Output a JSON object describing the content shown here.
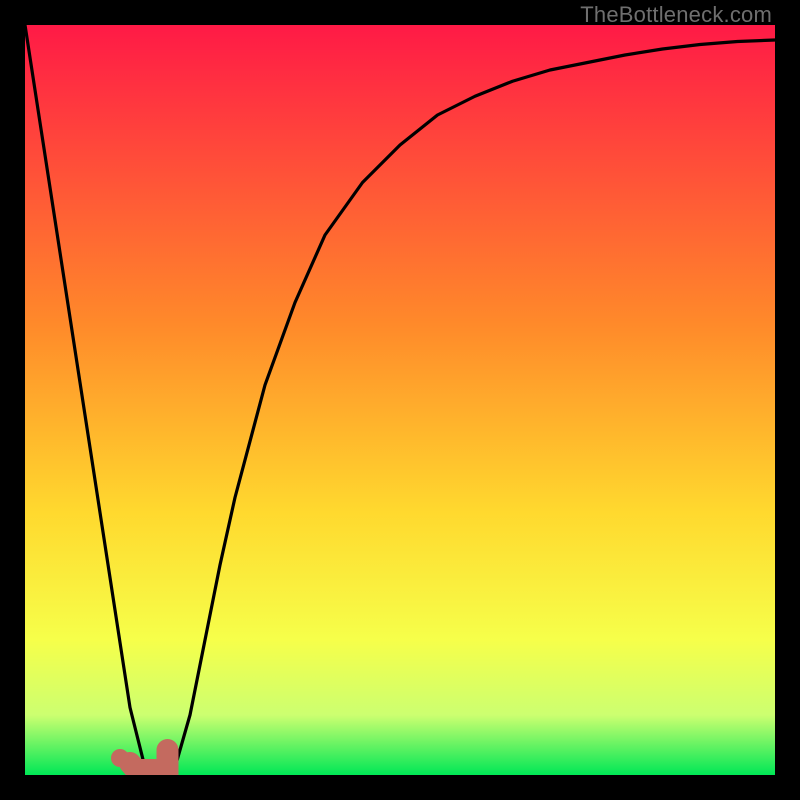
{
  "watermark": "TheBottleneck.com",
  "colors": {
    "gradient_top": "#ff1a46",
    "gradient_mid1": "#ff7a2f",
    "gradient_mid2": "#ffd92e",
    "gradient_mid3": "#f3ff4a",
    "gradient_bottom": "#00e756",
    "curve": "#000000",
    "marker": "#c46a5f",
    "frame": "#000000"
  },
  "chart_data": {
    "type": "line",
    "title": "",
    "xlabel": "",
    "ylabel": "",
    "xlim": [
      0,
      100
    ],
    "ylim": [
      0,
      100
    ],
    "series": [
      {
        "name": "bottleneck-curve",
        "x": [
          0,
          4,
          8,
          12,
          14,
          16,
          18,
          20,
          22,
          24,
          26,
          28,
          32,
          36,
          40,
          45,
          50,
          55,
          60,
          65,
          70,
          75,
          80,
          85,
          90,
          95,
          100
        ],
        "values": [
          100,
          74,
          48,
          22,
          9,
          1,
          0,
          1,
          8,
          18,
          28,
          37,
          52,
          63,
          72,
          79,
          84,
          88,
          90.5,
          92.5,
          94,
          95,
          96,
          96.8,
          97.4,
          97.8,
          98
        ]
      }
    ],
    "minimum_region": {
      "x_start": 14,
      "x_end": 19,
      "y": 0
    },
    "gradient_stops_percent": [
      {
        "pos": 0,
        "color": "#ff1a46"
      },
      {
        "pos": 40,
        "color": "#ff8a2a"
      },
      {
        "pos": 65,
        "color": "#ffd92e"
      },
      {
        "pos": 82,
        "color": "#f6ff4a"
      },
      {
        "pos": 92,
        "color": "#ccff70"
      },
      {
        "pos": 100,
        "color": "#00e756"
      }
    ]
  }
}
